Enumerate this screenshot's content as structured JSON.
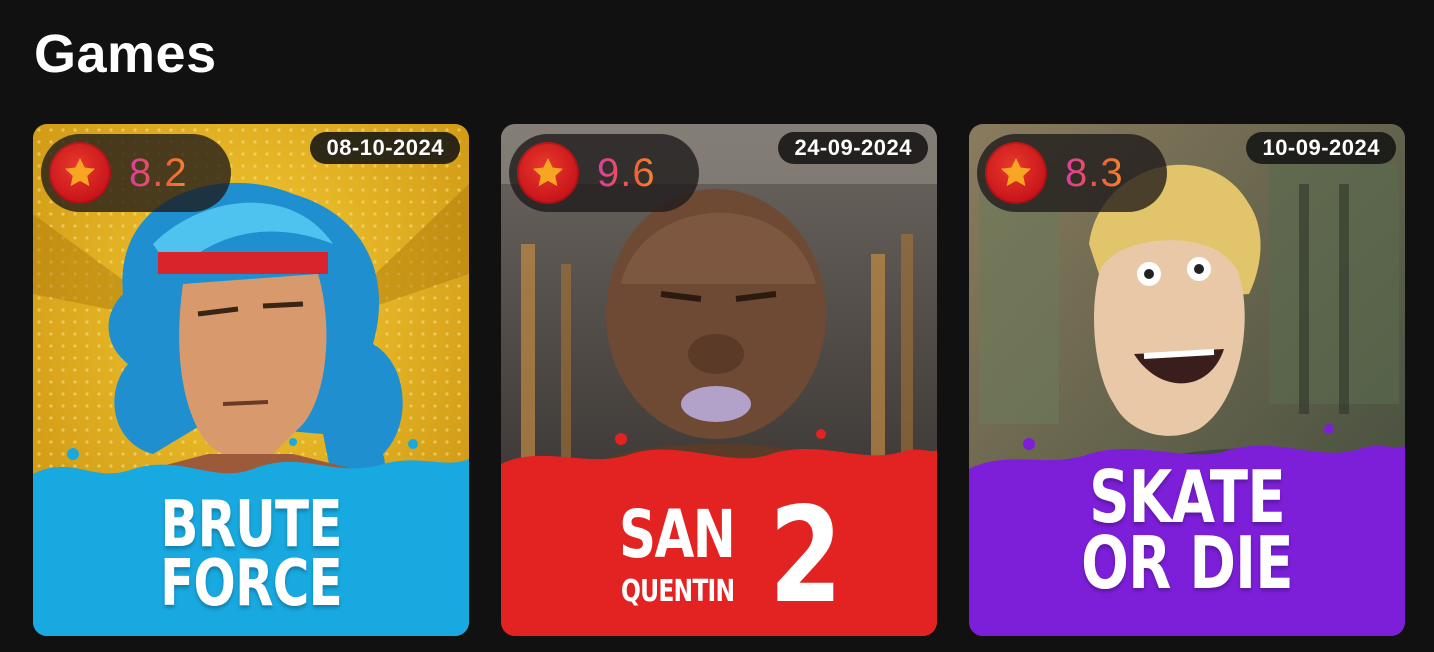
{
  "section": {
    "title": "Games"
  },
  "games": [
    {
      "rating": "8.2",
      "date": "08-10-2024",
      "title_line1": "BRUTE",
      "title_line2": "FORCE",
      "colors": {
        "bg": "#e8b51f",
        "splash": "#18a9e0"
      }
    },
    {
      "rating": "9.6",
      "date": "24-09-2024",
      "title_line1": "SAN",
      "title_line2": "QUENTIN",
      "title_number": "2",
      "colors": {
        "bg": "#3b3835",
        "splash": "#e32322"
      }
    },
    {
      "rating": "8.3",
      "date": "10-09-2024",
      "title_line1": "SKATE",
      "title_line2": "OR DIE",
      "colors": {
        "bg": "#5f6b4e",
        "splash": "#7d1fd8"
      }
    }
  ],
  "icons": {
    "rating": "star-icon"
  },
  "accent": {
    "rating_gradient_start": "#d93fa0",
    "rating_gradient_end": "#f6882e",
    "star_bg": "#c8141a",
    "star": "#f7a623"
  }
}
